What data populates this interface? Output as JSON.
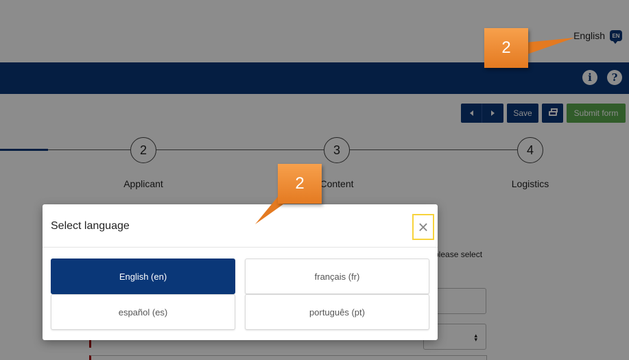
{
  "header": {
    "language_label": "English",
    "language_badge": "EN"
  },
  "navbar": {
    "info_icon_glyph": "i",
    "help_icon_glyph": "?"
  },
  "toolbar": {
    "save_label": "Save",
    "submit_label": "Submit form"
  },
  "stepper": {
    "steps": [
      {
        "number": "2",
        "label": "Applicant"
      },
      {
        "number": "3",
        "label": "Content"
      },
      {
        "number": "4",
        "label": "Logistics"
      }
    ]
  },
  "form": {
    "hint_text": "please select"
  },
  "modal": {
    "title": "Select language",
    "close_glyph": "×",
    "languages": [
      {
        "label": "English (en)",
        "selected": true
      },
      {
        "label": "français (fr)",
        "selected": false
      },
      {
        "label": "español (es)",
        "selected": false
      },
      {
        "label": "português (pt)",
        "selected": false
      }
    ]
  },
  "callouts": [
    {
      "number": "2"
    },
    {
      "number": "2"
    }
  ],
  "colors": {
    "brand_blue": "#0a3778",
    "submit_green": "#5aa84e",
    "callout_orange": "#e47a21",
    "highlight_yellow": "#f7d33c"
  }
}
